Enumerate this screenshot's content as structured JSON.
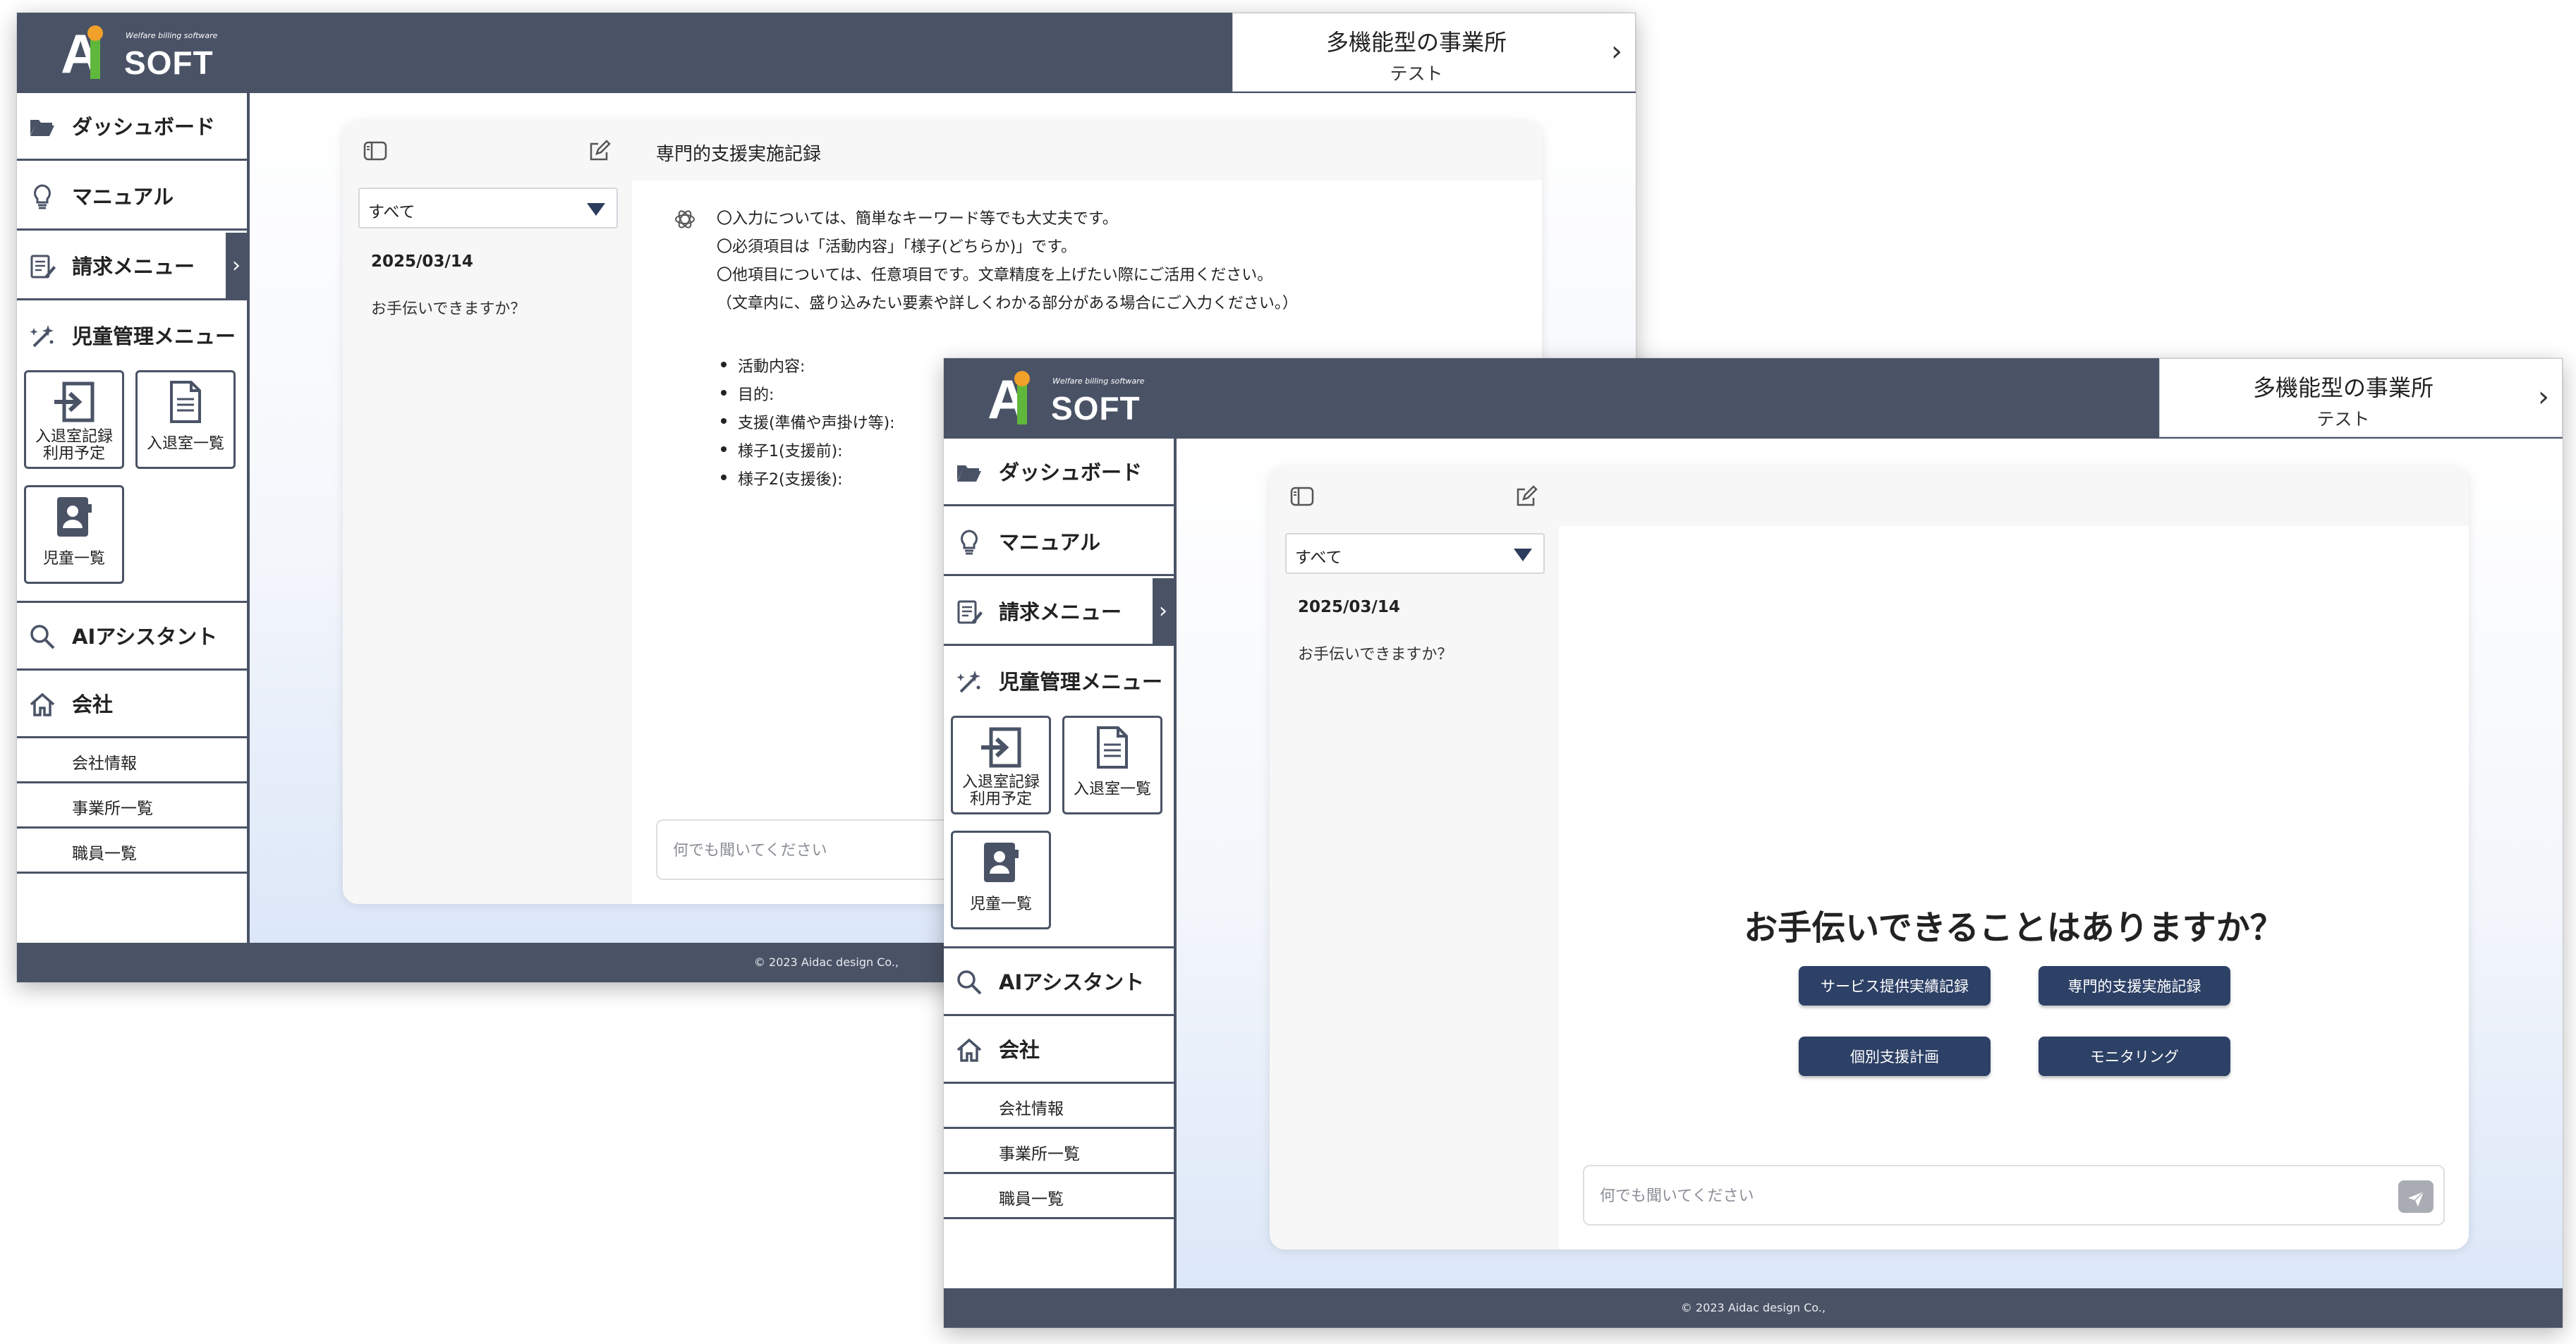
{
  "app": {
    "logo_tagline": "Welfare billing software",
    "logo_word": "SOFT",
    "logo_letter": "A",
    "office_name": "多機能型の事業所",
    "office_sub": "テスト",
    "footer": "© 2023 Aidac design Co.,"
  },
  "sidebar": {
    "items": [
      {
        "label": "ダッシュボード",
        "icon": "folder-open-icon"
      },
      {
        "label": "マニュアル",
        "icon": "lightbulb-icon"
      },
      {
        "label": "請求メニュー",
        "icon": "invoice-edit-icon"
      },
      {
        "label": "児童管理メニュー",
        "icon": "sparkle-wand-icon"
      },
      {
        "label": "AIアシスタント",
        "icon": "search-icon"
      },
      {
        "label": "会社",
        "icon": "home-icon"
      }
    ],
    "tiles": [
      {
        "label_line1": "入退室記録",
        "label_line2": "利用予定",
        "icon": "enter-icon"
      },
      {
        "label_line1": "入退室一覧",
        "icon": "document-icon"
      },
      {
        "label_line1": "児童一覧",
        "icon": "contact-book-icon"
      }
    ],
    "company_sub": [
      "会社情報",
      "事業所一覧",
      "職員一覧"
    ]
  },
  "chat": {
    "filter_value": "すべて",
    "history": [
      {
        "date": "2025/03/14",
        "title": "お手伝いできますか？"
      }
    ],
    "input_placeholder": "何でも聞いてください"
  },
  "back_window": {
    "title": "専門的支援実施記録",
    "intro_lines": [
      "〇入力については、簡単なキーワード等でも大丈夫です。",
      "〇必須項目は「活動内容」「様子(どちらか)」です。",
      "〇他項目については、任意項目です。文章精度を上げたい際にご活用ください。",
      "（文章内に、盛り込みたい要素や詳しくわかる部分がある場合にご入力ください。）"
    ],
    "fields": [
      "活動内容:",
      "目的:",
      "支援(準備や声掛け等):",
      "様子1(支援前):",
      "様子2(支援後):"
    ]
  },
  "front_window": {
    "welcome": "お手伝いできることはありますか？",
    "quick_buttons": [
      "サービス提供実績記録",
      "専門的支援実施記録",
      "個別支援計画",
      "モニタリング"
    ]
  },
  "colors": {
    "header": "#4a5366",
    "accent_button": "#2d4066",
    "logo_green": "#5fb83c",
    "logo_orange": "#f1a02a"
  }
}
